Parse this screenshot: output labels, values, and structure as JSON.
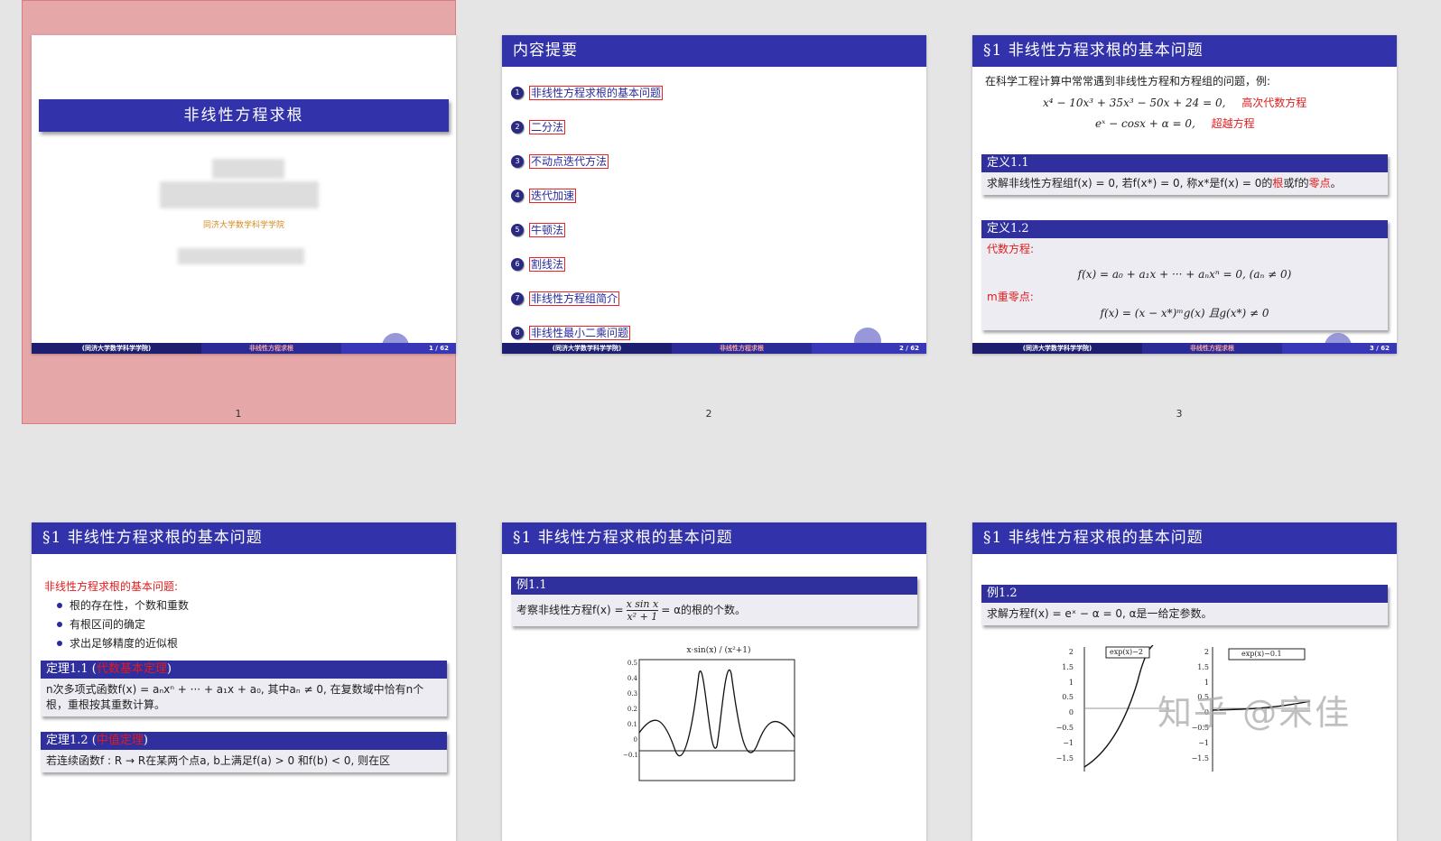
{
  "slides": {
    "s1": {
      "title": "非线性方程求根",
      "affiliation": "同济大学数学科学学院",
      "footer_left": "(同济大学数学科学学院)",
      "footer_mid": "非线性方程求根",
      "footer_page": "1 / 62",
      "page_number": "1"
    },
    "s2": {
      "header": "内容提要",
      "toc": [
        {
          "num": "1",
          "label": "非线性方程求根的基本问题"
        },
        {
          "num": "2",
          "label": "二分法"
        },
        {
          "num": "3",
          "label": "不动点迭代方法"
        },
        {
          "num": "4",
          "label": "迭代加速"
        },
        {
          "num": "5",
          "label": "牛顿法"
        },
        {
          "num": "6",
          "label": "割线法"
        },
        {
          "num": "7",
          "label": "非线性方程组简介"
        },
        {
          "num": "8",
          "label": "非线性最小二乘问题"
        }
      ],
      "footer_left": "(同济大学数学科学学院)",
      "footer_mid": "非线性方程求根",
      "footer_page": "2 / 62",
      "page_number": "2"
    },
    "s3": {
      "header": "§1 非线性方程求根的基本问题",
      "intro": "在科学工程计算中常常遇到非线性方程和方程组的问题，例:",
      "eq1": "x⁴ − 10x³ + 35x³ − 50x + 24 = 0,",
      "eq1_tag": "高次代数方程",
      "eq2": "eˣ − cosx + α = 0,",
      "eq2_tag": "超越方程",
      "def1_title": "定义1.1",
      "def1_body_a": "求解非线性方程组f(x) = 0, 若f(x*) = 0, 称x*是f(x) = 0的",
      "def1_body_root": "根",
      "def1_body_b": "或f的",
      "def1_body_zero": "零点",
      "def1_body_end": "。",
      "def2_title": "定义1.2",
      "def2_alg": "代数方程:",
      "def2_eq": "f(x) = a₀ + a₁x + ··· + aₙxⁿ = 0,    (aₙ ≠ 0)",
      "def2_mzero": "m重零点:",
      "def2_eq2": "f(x) = (x − x*)ᵐg(x)  且g(x*) ≠ 0",
      "footer_left": "(同济大学数学科学学院)",
      "footer_mid": "非线性方程求根",
      "footer_page": "3 / 62",
      "page_number": "3"
    },
    "s4": {
      "header": "§1 非线性方程求根的基本问题",
      "lead": "非线性方程求根的基本问题:",
      "bullets": [
        "根的存在性，个数和重数",
        "有根区间的确定",
        "求出足够精度的近似根"
      ],
      "thm1_title_a": "定理1.1 (",
      "thm1_title_red": "代数基本定理",
      "thm1_title_b": ")",
      "thm1_body": "n次多项式函数f(x) = aₙxⁿ + ··· + a₁x + a₀, 其中aₙ ≠ 0, 在复数域中恰有n个根，重根按其重数计算。",
      "thm2_title_a": "定理1.2 (",
      "thm2_title_red": "中值定理",
      "thm2_title_b": ")",
      "thm2_body": "若连续函数f : R → R在某两个点a, b上满足f(a) > 0 和f(b) < 0, 则在区"
    },
    "s5": {
      "header": "§1 非线性方程求根的基本问题",
      "ex_title": "例1.1",
      "ex_body_a": "考察非线性方程f(x) = ",
      "ex_frac_num": "x sin x",
      "ex_frac_den": "x² + 1",
      "ex_body_b": " = α的根的个数。",
      "plot_title": "x·sin(x) / (x²+1)",
      "y_ticks": [
        "0.5",
        "0.4",
        "0.3",
        "0.2",
        "0.1",
        "0",
        "−0.1"
      ]
    },
    "s6": {
      "header": "§1 非线性方程求根的基本问题",
      "ex_title": "例1.2",
      "ex_body": "求解方程f(x) = eˣ − α = 0, α是一给定参数。",
      "legend1": "exp(x)−2",
      "legend2": "exp(x)−0.1",
      "y_ticks": [
        "2",
        "1.5",
        "1",
        "0.5",
        "0",
        "−0.5",
        "−1",
        "−1.5"
      ],
      "watermark": "知乎 @宋佳"
    }
  }
}
